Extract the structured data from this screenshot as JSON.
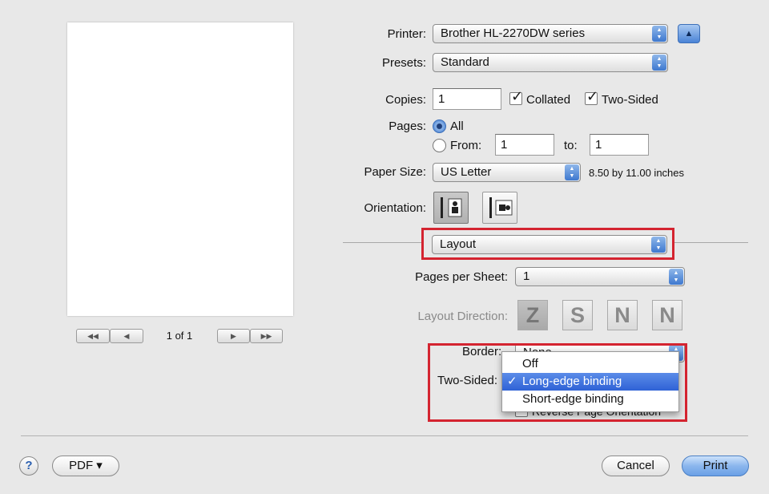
{
  "print_options": {
    "printer_label": "Printer:",
    "printer_value": "Brother HL-2270DW series",
    "presets_label": "Presets:",
    "presets_value": "Standard",
    "copies_label": "Copies:",
    "copies_value": "1",
    "collated_label": "Collated",
    "collated_checked": true,
    "two_sided_label": "Two-Sided",
    "two_sided_checked": true,
    "pages_label": "Pages:",
    "pages_all_label": "All",
    "pages_from_label": "From:",
    "pages_from_value": "1",
    "pages_to_label": "to:",
    "pages_to_value": "1",
    "pages_selected": "All",
    "paper_size_label": "Paper Size:",
    "paper_size_value": "US Letter",
    "paper_size_dimensions": "8.50 by 11.00 inches",
    "orientation_label": "Orientation:",
    "orientation_selected": "portrait"
  },
  "section_popup": {
    "value": "Layout"
  },
  "layout": {
    "pages_per_sheet_label": "Pages per Sheet:",
    "pages_per_sheet_value": "1",
    "layout_direction_label": "Layout Direction:",
    "layout_direction_icons": [
      "Z",
      "S",
      "N",
      "N"
    ],
    "border_label": "Border:",
    "border_value": "None",
    "two_sided_label": "Two-Sided:",
    "reverse_label": "Reverse Page Orientation",
    "two_sided_menu": {
      "items": [
        {
          "label": "Off",
          "selected": false
        },
        {
          "label": "Long-edge binding",
          "selected": true
        },
        {
          "label": "Short-edge binding",
          "selected": false
        }
      ],
      "checkmark": "✓"
    }
  },
  "preview": {
    "page_indicator": "1 of 1",
    "first_icon": "◀◀",
    "prev_icon": "◀",
    "next_icon": "▶",
    "last_icon": "▶▶"
  },
  "footer": {
    "help_label": "?",
    "pdf_label": "PDF ▾",
    "cancel_label": "Cancel",
    "print_label": "Print"
  },
  "colors": {
    "highlight": "#d42430",
    "accent": "#3e78cf",
    "background": "#e8e8e8"
  }
}
